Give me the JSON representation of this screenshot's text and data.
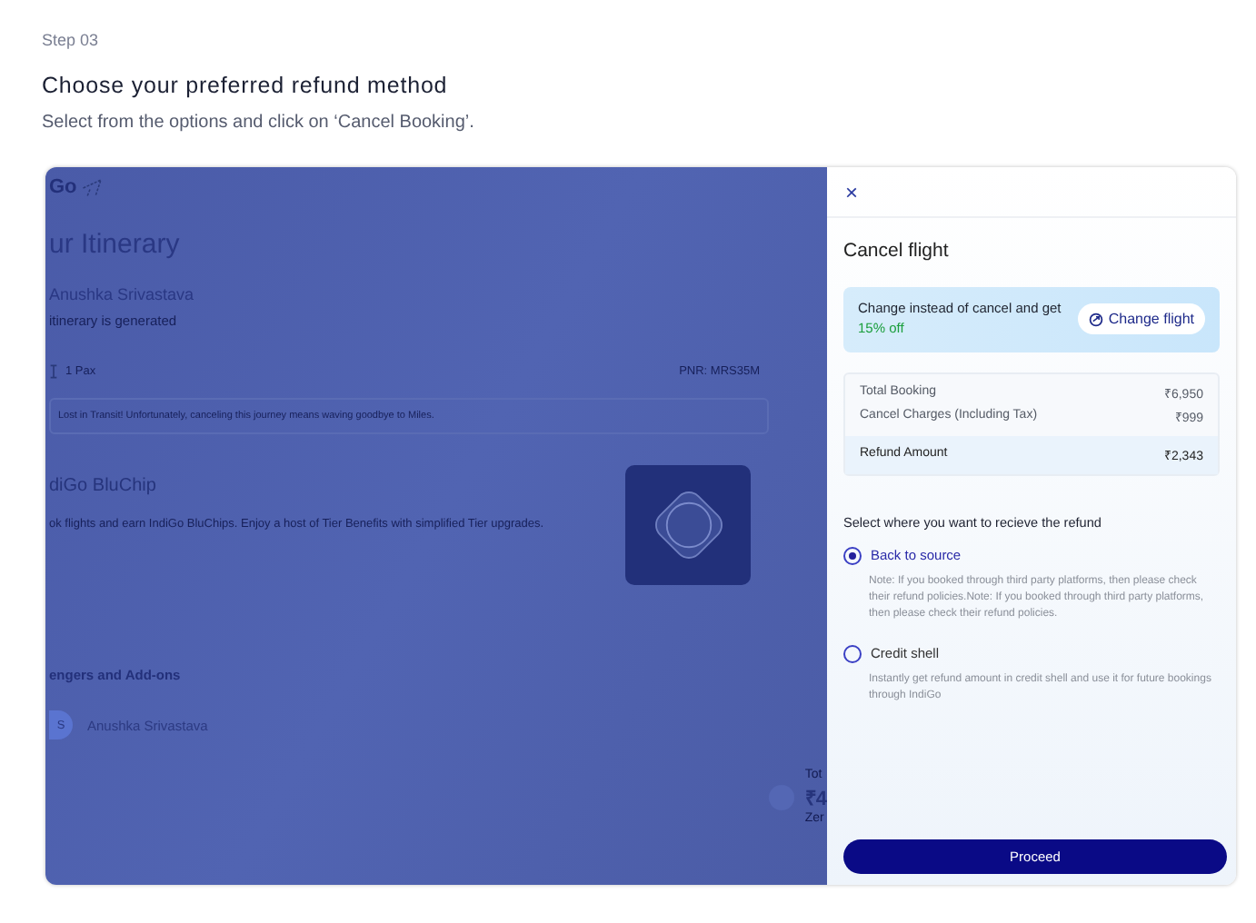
{
  "step": "Step 03",
  "heading": "Choose your preferred refund method",
  "subtitle": "Select from the options and click on ‘Cancel Booking’.",
  "background_page": {
    "logo": "Go",
    "title": "ur Itinerary",
    "greeting": "Anushka Srivastava",
    "status": "itinerary is generated",
    "pax": "1 Pax",
    "pnr": "PNR: MRS35M",
    "notice": "Lost in Transit! Unfortunately, canceling this journey means waving goodbye to Miles.",
    "bluchip_title": "diGo BluChip",
    "bluchip_text": "ok flights and earn IndiGo BluChips. Enjoy a host of Tier Benefits with simplified Tier upgrades.",
    "passengers_title": "engers and Add-ons",
    "passengers": [
      {
        "initials": "S",
        "name": "Anushka Srivastava"
      }
    ],
    "total_label": "Tot",
    "total_value": "₹4",
    "total_note": "Zer"
  },
  "drawer": {
    "close": "×",
    "title": "Cancel flight",
    "promo": {
      "text": "Change instead of cancel and get",
      "highlight": "15% off",
      "button": "Change flight"
    },
    "summary": [
      {
        "label": "Total Booking",
        "value": "₹6,950",
        "highlighted": false
      },
      {
        "label": "Cancel Charges (Including Tax)",
        "value": "₹999",
        "highlighted": false
      },
      {
        "label": "Refund Amount",
        "value": "₹2,343",
        "highlighted": true
      }
    ],
    "prompt": "Select where you want to recieve the refund",
    "options": [
      {
        "label": "Back to source",
        "selected": true,
        "note": "Note: If you booked through third party platforms, then please check their refund policies.Note: If you booked through third party platforms, then please check their refund policies."
      },
      {
        "label": "Credit shell",
        "selected": false,
        "note": "Instantly get refund amount in credit shell and use it for future bookings through IndiGo"
      }
    ],
    "proceed": "Proceed"
  }
}
